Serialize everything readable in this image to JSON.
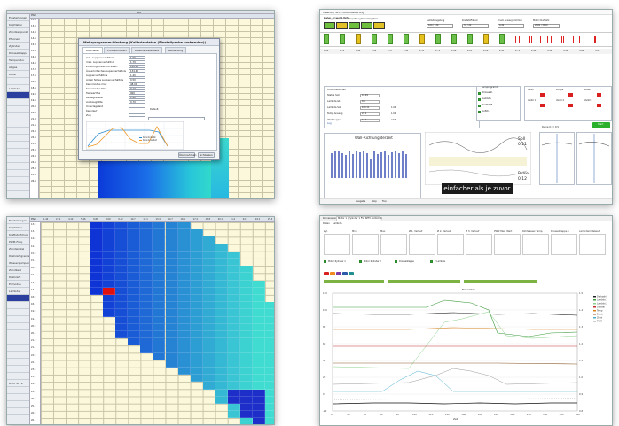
{
  "topleft": {
    "title": "Bbt",
    "corner_label": "Pfeil",
    "side_items": [
      "Einstellungen",
      "Kopfdaten",
      "Zündzeitpunkt",
      "Pfannen",
      "Zylinder",
      "Drosselklappe",
      "Temperatur",
      "Abgas",
      "Datei",
      "",
      "Lambda",
      "",
      "",
      "",
      "",
      "",
      "",
      "",
      "",
      "",
      "",
      "",
      "",
      "",
      "",
      "",
      "A-L7 & 7K",
      "",
      "",
      ""
    ],
    "sel_index": 11,
    "row_labels": [
      "13.0",
      "13.5",
      "14.0",
      "14.5",
      "15.0",
      "15.5",
      "16.0",
      "16.5",
      "17.0",
      "17.5",
      "18.0",
      "18.5",
      "19.0",
      "19.5",
      "20.0",
      "20.5",
      "21.0",
      "21.5",
      "22.0",
      "22.5",
      "23.0",
      "23.5",
      "24.0",
      "24.5",
      "25.0",
      "25.5",
      "26.0"
    ],
    "dialog": {
      "title": "Mehrprogramm-Wartung (Kalibrierdaten (Einstellprobe vorhanden))",
      "tabs": [
        "Kopfdaten",
        "Protokolldaten",
        "Kalibrierdatensatz",
        "Bedienung"
      ],
      "params": [
        {
          "label": "min. Luppenverhältnis",
          "value": "1.00"
        },
        {
          "label": "max. Luppenverhältnis",
          "value": "1.79"
        },
        {
          "label": "Zündungsunterdrückwert",
          "value": "128.00"
        },
        {
          "label": "Äußerkritisches Lupenverhältnis",
          "value": "134.40"
        },
        {
          "label": "Luppenverhältnis",
          "value": "1.40"
        },
        {
          "label": "Anteil fettes Luppenverhältnis",
          "value": "0.50"
        },
        {
          "label": "Kennmodus max",
          "value": "48.00"
        },
        {
          "label": "Kennmodus Max",
          "value": "0.13"
        },
        {
          "label": "Tastwartfee",
          "value": "900"
        },
        {
          "label": "Bewegfenster",
          "value": "1.40"
        },
        {
          "label": "Ausbauglätte",
          "value": "0.79"
        },
        {
          "label": "Unterlagelast",
          "value": ""
        },
        {
          "label": "Kennlauf",
          "value": "Default"
        },
        {
          "label": "Zug",
          "value": ""
        }
      ],
      "legend": [
        "Kennlinie Ist",
        "Kennlinie Soll"
      ],
      "ok_label": "Übernehmen",
      "cancel_label": "Schließen"
    }
  },
  "topright": {
    "title": "Freeroll / SEFC Motorsteuerung",
    "menu": [
      "Datei",
      "Ansicht",
      "Hilfe"
    ],
    "header_boxes": [
      "Zündung",
      "Motorleistung",
      "Einspritzung",
      "Drosselklappe",
      "Last"
    ],
    "header_labels": [
      "Lambdaregelung",
      "Kraftstoffdruck",
      "Druck Ansaugkrümmer",
      "Motor Drehzahl"
    ],
    "header_vals": [
      "100 / 130",
      "33 / 22",
      "0.42",
      "2000 / 3000"
    ],
    "segment_values": [
      "0.00",
      "0.72",
      "0.94",
      "1.02",
      "1.17",
      "1.41",
      "1.55",
      "1.71",
      "1.88",
      "2.03",
      "2.26",
      "2.45",
      "2.71",
      "2.90",
      "3.16",
      "3.41",
      "3.68",
      "3.96"
    ],
    "info": {
      "title": "Informationen",
      "rows": [
        {
          "label": "Status Soll",
          "v1": "10.09",
          "v2": ""
        },
        {
          "label": "Lambda Ist",
          "v1": "0.1",
          "v2": ""
        },
        {
          "label": "Lambda Soll",
          "v1": "180.11",
          "v2": "1.00"
        },
        {
          "label": "Temp Ansaug",
          "v1": "22.1",
          "v2": "1.00"
        },
        {
          "label": "Wert Luppe",
          "v1": "11.2",
          "v2": "2.53"
        }
      ],
      "link": "Log"
    },
    "controls": {
      "left_title": "Lernprogramm",
      "labels": [
        "Drosselkl.",
        "Lambda",
        "Kraftstoff",
        "Luftdr."
      ],
      "right_labels": [
        "Ventil",
        "Pumpe",
        "Lüfter",
        "Ventil 1",
        "Ventil 2",
        "Ventil 3"
      ],
      "start_label": "Start"
    },
    "chart_title": "Wall-Richtung derzeit",
    "chart_status": "Kurve 0.0 / 0.5",
    "right_reading": "Soll",
    "right_reading_val": "0.11",
    "right_reading2": "Pulse",
    "right_reading2_val": "0.12",
    "banner": "einfacher als je zuvor",
    "footer_labels": [
      "Ausgabe",
      "Stop",
      "Frei"
    ]
  },
  "bottomleft": {
    "corner_label": "Pfeil",
    "side_items": [
      "Einstellungen",
      "Kopfdaten",
      "Kraftstoffdruck",
      "PWM-Freq.",
      "Zündwinkel",
      "Drehzahlgrenzen",
      "Wasserpumpen",
      "Zündkerz",
      "Drehzahl",
      "Eilmodus",
      "Lambda",
      "",
      "",
      "",
      "",
      "",
      "",
      "",
      "",
      "",
      "",
      "",
      "",
      "A-M7 & 7K",
      "",
      "",
      "",
      ""
    ],
    "sel_index": 11,
    "col_labels": [
      "1.42",
      "2.71",
      "4.12",
      "5.46",
      "6.81",
      "8.09",
      "9.42",
      "10.7",
      "12.1",
      "13.4",
      "14.7",
      "16.1",
      "17.4",
      "18.8",
      "20.1",
      "21.4",
      "22.7",
      "24.1",
      "25.4"
    ],
    "row_labels": [
      "13.0",
      "13.5",
      "14.0",
      "14.5",
      "15.0",
      "15.5",
      "16.0",
      "16.5",
      "17.0",
      "17.5",
      "18.0",
      "18.5",
      "19.0",
      "19.5",
      "20.0",
      "20.5",
      "21.0",
      "21.5",
      "22.0",
      "22.5",
      "23.0",
      "23.5",
      "24.0",
      "24.5",
      "25.0",
      "25.5",
      "26.0",
      "26.5"
    ]
  },
  "bottomright": {
    "title": "Motor 1 (Zylinder 1 FS) SEFC (LOGO 2)",
    "tabs": [
      "Kurvenansicht",
      "Daten",
      "Lambda"
    ],
    "stats_headers": [
      "Zyl.",
      "Min",
      "Max",
      "Ø 1. Verlauf",
      "Ø 2. Verlauf",
      "Ø 3. Verlauf",
      "PWM Max. Wert",
      "Kühlwasser Temp.",
      "Drosselklappe 1",
      "Lambdamittelwert"
    ],
    "checks": [
      "Motor Zylinder 1",
      "Motor Zylinder 2",
      "Drosselklappe",
      "2 Lambda"
    ],
    "chart_title": "Messdaten",
    "x_label": "Zeit",
    "y_ticks": [
      "120",
      "100",
      "80",
      "60",
      "40",
      "20",
      "0",
      "-20"
    ],
    "y_ticks_r": [
      "1.5",
      "1.4",
      "1.3",
      "1.2",
      "1.1",
      "1.0",
      "0.9",
      "0.8"
    ],
    "x_ticks": [
      "0",
      "20",
      "40",
      "60",
      "80",
      "100",
      "120",
      "140",
      "160",
      "180",
      "200",
      "220",
      "240",
      "260",
      "280",
      "300"
    ],
    "legend": [
      "Drehzahl",
      "Lambda 1",
      "Lambda 2",
      "Drossel",
      "Temp",
      "Druck",
      "Zünd",
      "PWM"
    ]
  }
}
